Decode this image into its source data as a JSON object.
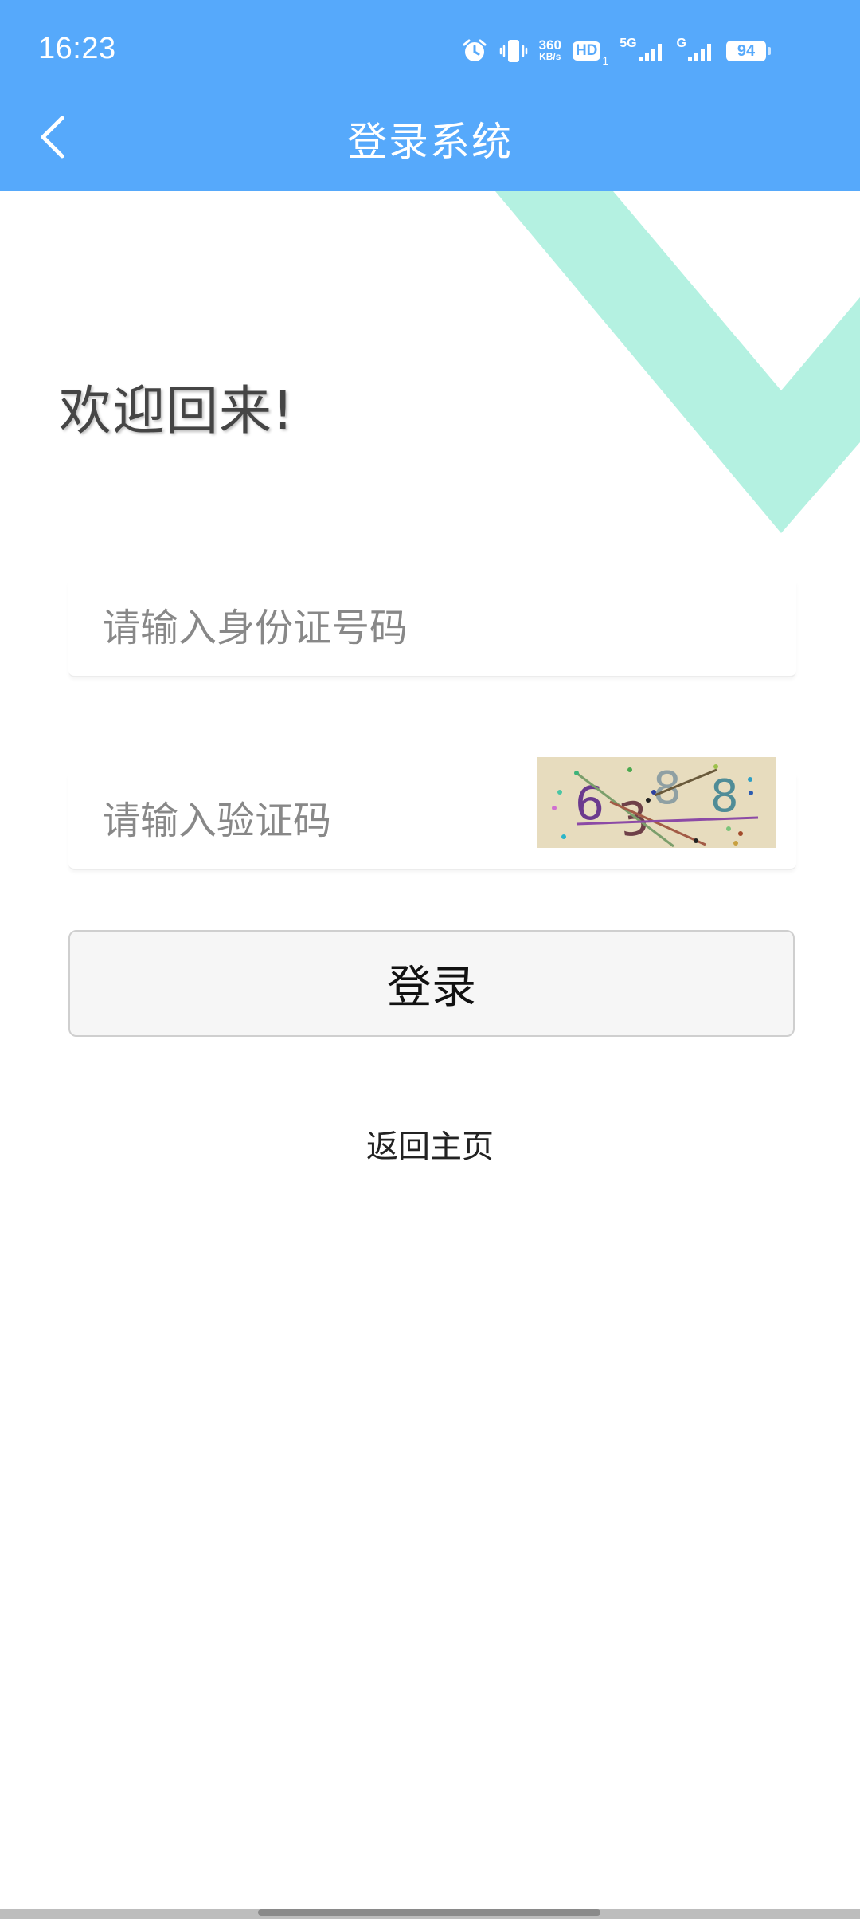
{
  "status_bar": {
    "time": "16:23",
    "net_speed_value": "360",
    "net_speed_unit": "KB/s",
    "hd_label": "HD",
    "hd_sub": "1",
    "network_primary": "5G",
    "network_secondary": "G",
    "battery": "94",
    "icons": [
      "alarm-icon",
      "vibrate-icon",
      "signal-icon",
      "signal-icon",
      "battery-icon"
    ]
  },
  "header": {
    "title": "登录系统",
    "back_icon": "chevron-left-icon",
    "background_color": "#56A9FB"
  },
  "decoration": {
    "accent_color": "#B4F1E1"
  },
  "welcome_text": "欢迎回来!",
  "form": {
    "id_placeholder": "请输入身份证号码",
    "code_placeholder": "请输入验证码",
    "captcha_characters": [
      "6",
      "3",
      "8",
      "8"
    ],
    "login_label": "登录",
    "home_link": "返回主页"
  }
}
